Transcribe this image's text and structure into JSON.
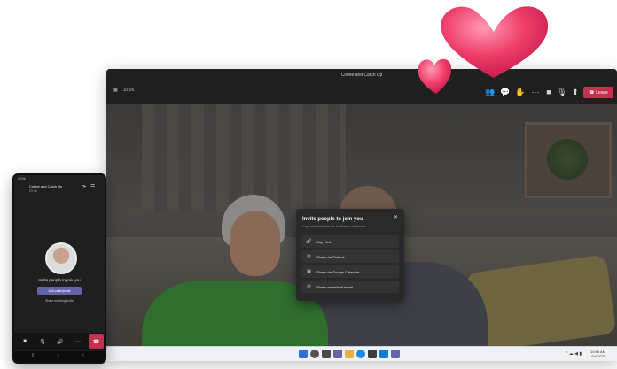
{
  "desktop": {
    "title": "Coffee and Catch Up",
    "timer": "10:06",
    "leave_label": "Leave",
    "toolbar_icons": [
      "people-icon",
      "chat-icon",
      "raise-hand-icon",
      "more-icon",
      "camera-icon",
      "mic-icon",
      "share-icon"
    ]
  },
  "dialog": {
    "title": "Invite people to join you",
    "subtitle": "Copy and share the link for Teams conference",
    "options": [
      {
        "label": "Copy link",
        "icon": "link-icon"
      },
      {
        "label": "Share via Outlook",
        "icon": "outlook-icon"
      },
      {
        "label": "Share via Google Calendar",
        "icon": "calendar-icon"
      },
      {
        "label": "Share via default email",
        "icon": "mail-icon"
      }
    ]
  },
  "taskbar": {
    "time": "10:56 AM",
    "date": "6/4/2021",
    "tray": "^ ☁ ◀ ▮"
  },
  "phone": {
    "status": "10:56",
    "title": "Coffee and Catch Up",
    "time": "00:46",
    "invite_text": "Invite people to join you",
    "add_button": "Add participants",
    "share_text": "Share meeting invite",
    "nav": [
      "|||",
      "○",
      "<"
    ]
  },
  "colors": {
    "leave_red": "#c4314b",
    "teams_purple": "#6264a7",
    "heart_pink": "#ef3d6a"
  }
}
